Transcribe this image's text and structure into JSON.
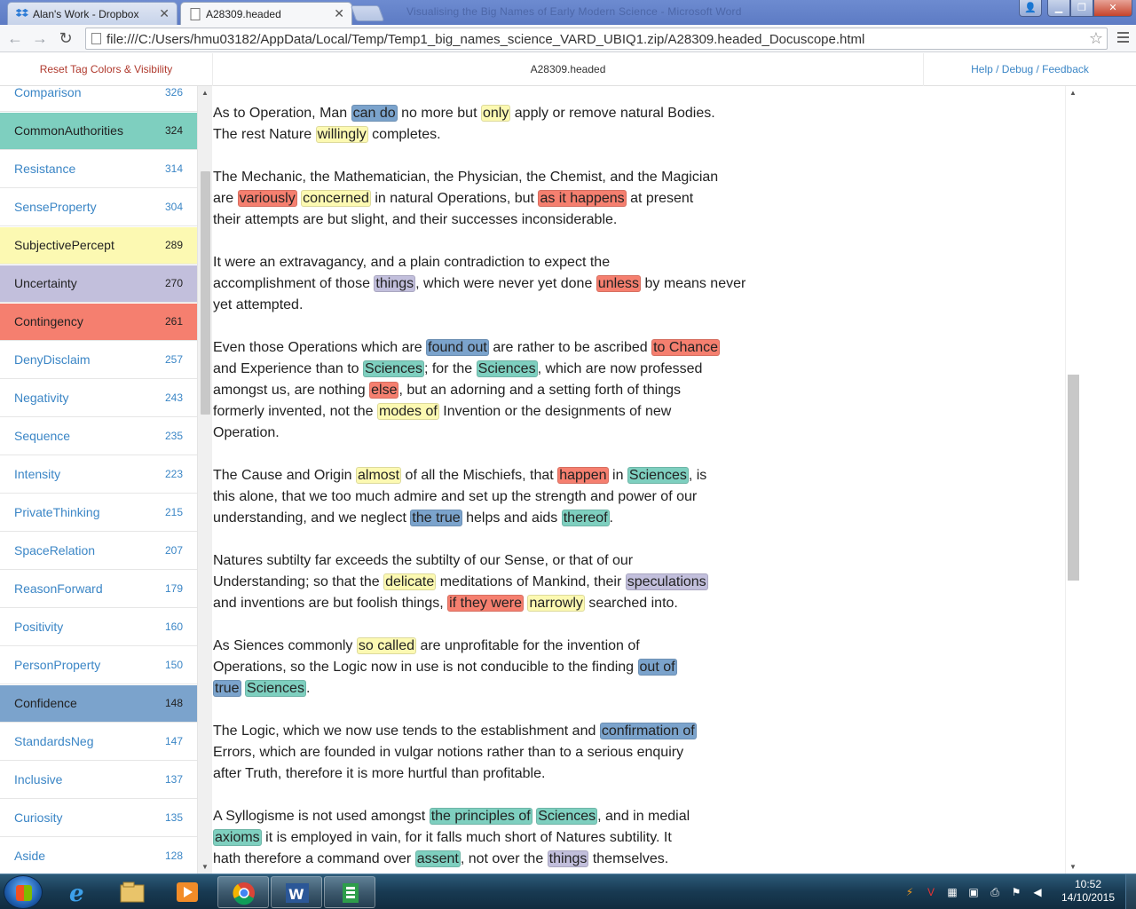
{
  "browser": {
    "tabs": [
      {
        "title": "Alan's Work - Dropbox",
        "active": false
      },
      {
        "title": "A28309.headed",
        "active": true
      }
    ],
    "ghost_title": "Visualising the Big Names of Early Modern Science - Microsoft Word",
    "url": "file:///C:/Users/hmu03182/AppData/Local/Temp/Temp1_big_names_science_VARD_UBIQ1.zip/A28309.headed_Docuscope.html"
  },
  "header": {
    "reset_label": "Reset Tag Colors & Visibility",
    "doc_title": "A28309.headed",
    "help_label": "Help / Debug / Feedback"
  },
  "colors": {
    "blue": "#7ba3cc",
    "teal": "#7ecfbf",
    "yellow": "#fcf9b2",
    "purple": "#c2bfdc",
    "red": "#f57f6f",
    "link": "#3b86c6"
  },
  "categories": [
    {
      "name": "Comparison",
      "count": "326",
      "color": ""
    },
    {
      "name": "CommonAuthorities",
      "count": "324",
      "color": "teal"
    },
    {
      "name": "Resistance",
      "count": "314",
      "color": ""
    },
    {
      "name": "SenseProperty",
      "count": "304",
      "color": ""
    },
    {
      "name": "SubjectivePercept",
      "count": "289",
      "color": "yellow"
    },
    {
      "name": "Uncertainty",
      "count": "270",
      "color": "purple"
    },
    {
      "name": "Contingency",
      "count": "261",
      "color": "red"
    },
    {
      "name": "DenyDisclaim",
      "count": "257",
      "color": ""
    },
    {
      "name": "Negativity",
      "count": "243",
      "color": ""
    },
    {
      "name": "Sequence",
      "count": "235",
      "color": ""
    },
    {
      "name": "Intensity",
      "count": "223",
      "color": ""
    },
    {
      "name": "PrivateThinking",
      "count": "215",
      "color": ""
    },
    {
      "name": "SpaceRelation",
      "count": "207",
      "color": ""
    },
    {
      "name": "ReasonForward",
      "count": "179",
      "color": ""
    },
    {
      "name": "Positivity",
      "count": "160",
      "color": ""
    },
    {
      "name": "PersonProperty",
      "count": "150",
      "color": ""
    },
    {
      "name": "Confidence",
      "count": "148",
      "color": "blue"
    },
    {
      "name": "StandardsNeg",
      "count": "147",
      "color": ""
    },
    {
      "name": "Inclusive",
      "count": "137",
      "color": ""
    },
    {
      "name": "Curiosity",
      "count": "135",
      "color": ""
    },
    {
      "name": "Aside",
      "count": "128",
      "color": ""
    }
  ],
  "paragraphs": [
    [
      [
        [
          "As to Operation, Man ",
          ""
        ],
        [
          "can do",
          "blue"
        ],
        [
          " no more but ",
          ""
        ],
        [
          "only",
          "yellow"
        ],
        [
          " apply or remove natural Bodies.",
          ""
        ]
      ],
      [
        [
          "The rest Nature ",
          ""
        ],
        [
          "willingly",
          "yellow"
        ],
        [
          " completes.",
          ""
        ]
      ]
    ],
    [
      [
        [
          "The Mechanic, the Mathematician, the Physician, the Chemist, and the Magician",
          ""
        ]
      ],
      [
        [
          "are ",
          ""
        ],
        [
          "variously",
          "red"
        ],
        [
          " ",
          ""
        ],
        [
          "concerned",
          "yellow"
        ],
        [
          " in natural Operations, but ",
          ""
        ],
        [
          "as it happens",
          "red"
        ],
        [
          " at present",
          ""
        ]
      ],
      [
        [
          "their attempts are but slight, and their successes inconsiderable.",
          ""
        ]
      ]
    ],
    [
      [
        [
          "It were an extravagancy, and a plain contradiction to expect the",
          ""
        ]
      ],
      [
        [
          "accomplishment of those ",
          ""
        ],
        [
          "things",
          "purple"
        ],
        [
          ", which were never yet done ",
          ""
        ],
        [
          "unless",
          "red"
        ],
        [
          " by means never",
          ""
        ]
      ],
      [
        [
          "yet attempted.",
          ""
        ]
      ]
    ],
    [
      [
        [
          "Even those Operations which are ",
          ""
        ],
        [
          "found out",
          "blue"
        ],
        [
          " are rather to be ascribed ",
          ""
        ],
        [
          "to Chance",
          "red"
        ]
      ],
      [
        [
          "and Experience than to ",
          ""
        ],
        [
          "Sciences",
          "teal"
        ],
        [
          "; for the ",
          ""
        ],
        [
          "Sciences",
          "teal"
        ],
        [
          ", which are now professed",
          ""
        ]
      ],
      [
        [
          "amongst us, are nothing ",
          ""
        ],
        [
          "else",
          "red"
        ],
        [
          ", but an adorning and a setting forth of things",
          ""
        ]
      ],
      [
        [
          "formerly invented, not the ",
          ""
        ],
        [
          "modes of",
          "yellow"
        ],
        [
          " Invention or the designments of new",
          ""
        ]
      ],
      [
        [
          "Operation.",
          ""
        ]
      ]
    ],
    [
      [
        [
          "The Cause and Origin ",
          ""
        ],
        [
          "almost",
          "yellow"
        ],
        [
          " of all the Mischiefs, that ",
          ""
        ],
        [
          "happen",
          "red"
        ],
        [
          " in ",
          ""
        ],
        [
          "Sciences",
          "teal"
        ],
        [
          ", is",
          ""
        ]
      ],
      [
        [
          "this alone, that we too much admire and set up the strength and power of our",
          ""
        ]
      ],
      [
        [
          "understanding, and we neglect ",
          ""
        ],
        [
          "the true",
          "blue"
        ],
        [
          " helps and aids ",
          ""
        ],
        [
          "thereof",
          "teal"
        ],
        [
          ".",
          ""
        ]
      ]
    ],
    [
      [
        [
          "Natures subtilty far exceeds the subtilty of our Sense, or that of our",
          ""
        ]
      ],
      [
        [
          "Understanding; so that the ",
          ""
        ],
        [
          "delicate",
          "yellow"
        ],
        [
          " meditations of Mankind, their ",
          ""
        ],
        [
          "speculations",
          "purple"
        ]
      ],
      [
        [
          "and inventions are but foolish things, ",
          ""
        ],
        [
          "if they were",
          "red"
        ],
        [
          " ",
          ""
        ],
        [
          "narrowly",
          "yellow"
        ],
        [
          " searched into.",
          ""
        ]
      ]
    ],
    [
      [
        [
          "As Siences commonly ",
          ""
        ],
        [
          "so called",
          "yellow"
        ],
        [
          " are unprofitable for the invention of",
          ""
        ]
      ],
      [
        [
          "Operations, so the Logic now in use is not conducible to the finding ",
          ""
        ],
        [
          "out of",
          "blue"
        ]
      ],
      [
        [
          "true",
          "blue"
        ],
        [
          " ",
          ""
        ],
        [
          "Sciences",
          "teal"
        ],
        [
          ".",
          ""
        ]
      ]
    ],
    [
      [
        [
          "The Logic, which we now use tends to the establishment and ",
          ""
        ],
        [
          "confirmation of",
          "blue"
        ]
      ],
      [
        [
          "Errors, which are founded in vulgar notions rather than to a serious enquiry",
          ""
        ]
      ],
      [
        [
          "after Truth, therefore it is more hurtful than profitable.",
          ""
        ]
      ]
    ],
    [
      [
        [
          "A Syllogisme is not used amongst ",
          ""
        ],
        [
          "the principles of",
          "teal"
        ],
        [
          " ",
          ""
        ],
        [
          "Sciences",
          "teal"
        ],
        [
          ", and in medial",
          ""
        ]
      ],
      [
        [
          "axioms",
          "teal"
        ],
        [
          " it is employed in vain, for it falls much short of Natures subtility. It",
          ""
        ]
      ],
      [
        [
          "hath therefore a command over ",
          ""
        ],
        [
          "assent",
          "teal"
        ],
        [
          ", not over the ",
          ""
        ],
        [
          "things",
          "purple"
        ],
        [
          " themselves.",
          ""
        ]
      ]
    ]
  ],
  "taskbar": {
    "time": "10:52",
    "date": "14/10/2015"
  }
}
